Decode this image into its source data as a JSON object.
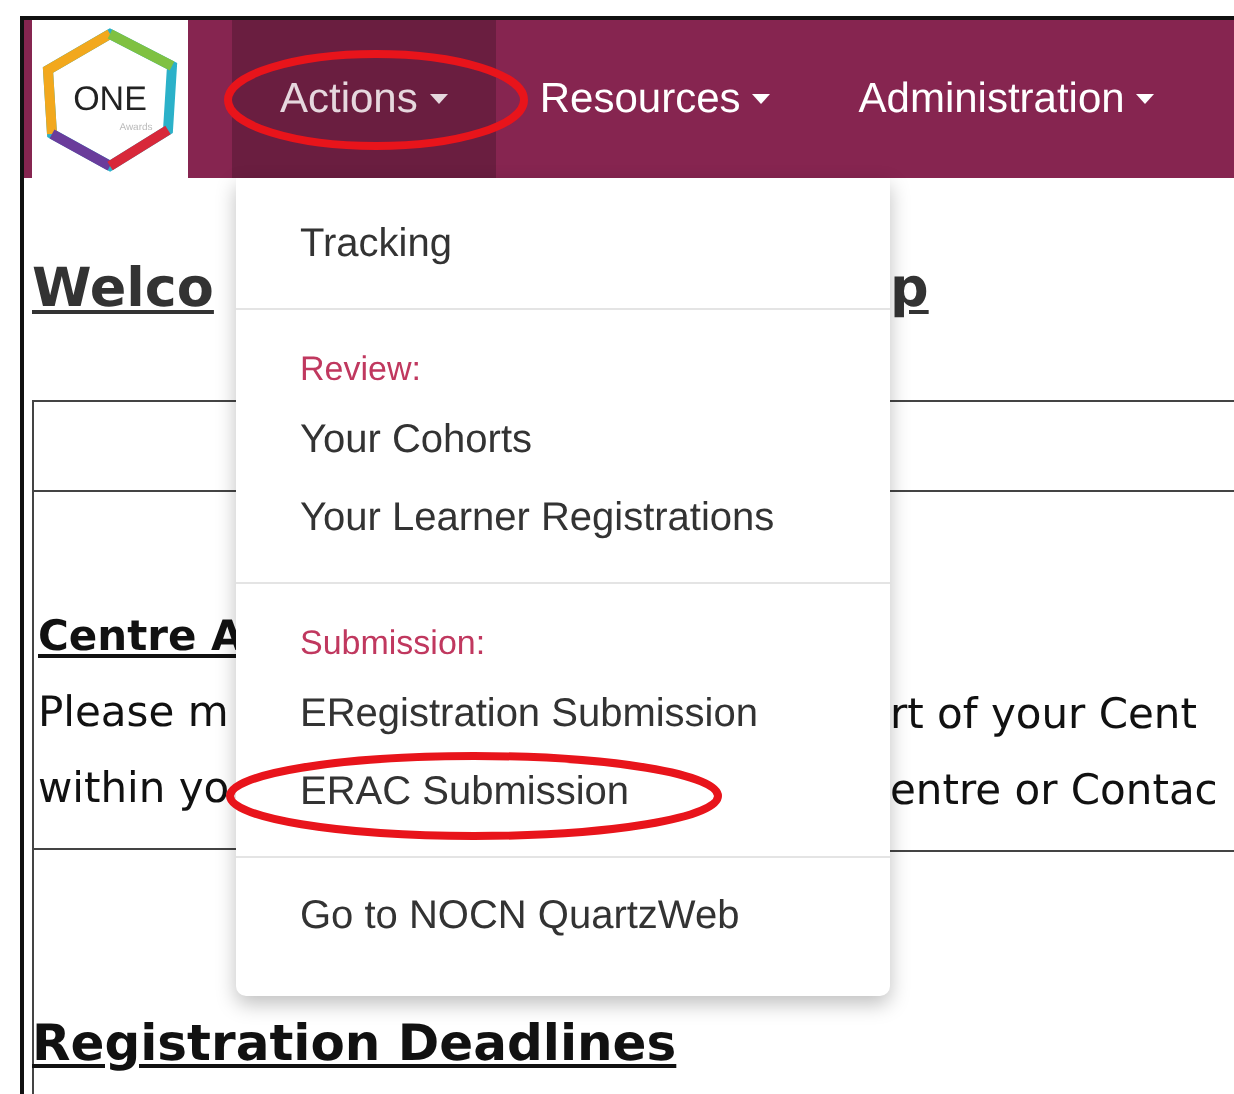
{
  "logo": {
    "text": "ONE",
    "subtext": "Awards"
  },
  "nav": [
    {
      "label": "Actions",
      "selected": true,
      "circled": true
    },
    {
      "label": "Resources",
      "selected": false,
      "circled": false
    },
    {
      "label": "Administration",
      "selected": false,
      "circled": false
    }
  ],
  "menu": [
    {
      "items": [
        {
          "label": "Tracking",
          "circled": false
        }
      ]
    },
    {
      "header": "Review:",
      "items": [
        {
          "label": "Your Cohorts",
          "circled": false
        },
        {
          "label": "Your Learner Registrations",
          "circled": false
        }
      ]
    },
    {
      "header": "Submission:",
      "items": [
        {
          "label": "ERegistration Submission",
          "circled": false
        },
        {
          "label": "ERAC Submission",
          "circled": true
        }
      ]
    },
    {
      "items": [
        {
          "label": "Go to NOCN QuartzWeb",
          "circled": false
        }
      ]
    }
  ],
  "page": {
    "heading_left": "Welco",
    "heading_right": "p",
    "section_title": "Centre A",
    "lines": [
      {
        "left": "Please m",
        "right": "rt of your Cent"
      },
      {
        "left": "within yo",
        "right": "entre or Contac"
      }
    ],
    "deadlines_title": "Registration Deadlines"
  }
}
